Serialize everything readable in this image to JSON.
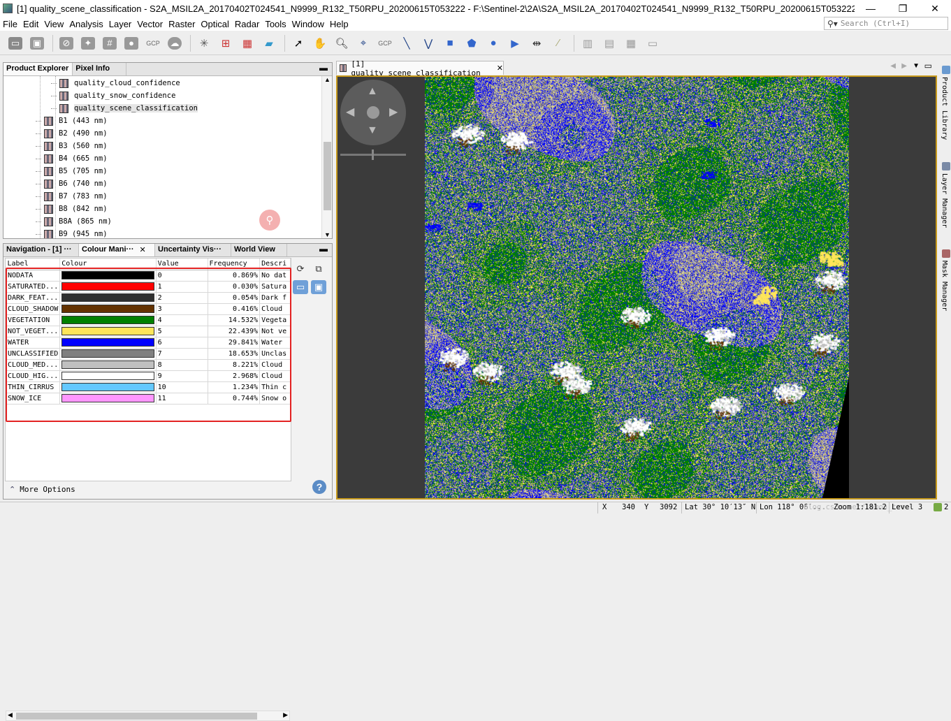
{
  "window": {
    "title": "[1] quality_scene_classification - S2A_MSIL2A_20170402T024541_N9999_R132_T50RPU_20200615T053222 - F:\\Sentinel-2\\2A\\S2A_MSIL2A_20170402T024541_N9999_R132_T50RPU_20200615T053222.SAFE\\MT...",
    "minimize": "—",
    "maximize": "❐",
    "close": "✕"
  },
  "menu": [
    "File",
    "Edit",
    "View",
    "Analysis",
    "Layer",
    "Vector",
    "Raster",
    "Optical",
    "Radar",
    "Tools",
    "Window",
    "Help"
  ],
  "search": {
    "placeholder": "Search (Ctrl+I)",
    "icon": "search-icon"
  },
  "toolbar": {
    "gcp1": "GCP",
    "gcp2": "GCP"
  },
  "product_explorer": {
    "tabs": [
      "Product Explorer",
      "Pixel Info"
    ],
    "items": [
      {
        "label": "quality_cloud_confidence",
        "indent": 2
      },
      {
        "label": "quality_snow_confidence",
        "indent": 2
      },
      {
        "label": "quality_scene_classification",
        "indent": 2,
        "selected": true
      },
      {
        "label": "B1 (443 nm)",
        "indent": 1
      },
      {
        "label": "B2 (490 nm)",
        "indent": 1
      },
      {
        "label": "B3 (560 nm)",
        "indent": 1
      },
      {
        "label": "B4 (665 nm)",
        "indent": 1
      },
      {
        "label": "B5 (705 nm)",
        "indent": 1
      },
      {
        "label": "B6 (740 nm)",
        "indent": 1
      },
      {
        "label": "B7 (783 nm)",
        "indent": 1
      },
      {
        "label": "B8 (842 nm)",
        "indent": 1
      },
      {
        "label": "B8A (865 nm)",
        "indent": 1
      },
      {
        "label": "B9 (945 nm)",
        "indent": 1
      }
    ]
  },
  "bottom_tabs": [
    "Navigation - [1] ···",
    "Colour Mani···",
    "Uncertainty Vis···",
    "World View"
  ],
  "colour_table": {
    "headers": [
      "Label",
      "Colour",
      "Value",
      "Frequency",
      "Descri"
    ],
    "rows": [
      {
        "label": "NODATA",
        "color": "#000000",
        "value": "0",
        "frequency": "0.869%",
        "description": "No dat"
      },
      {
        "label": "SATURATED...",
        "color": "#ff0000",
        "value": "1",
        "frequency": "0.030%",
        "description": "Satura"
      },
      {
        "label": "DARK_FEAT...",
        "color": "#2f2f2f",
        "value": "2",
        "frequency": "0.054%",
        "description": "Dark f"
      },
      {
        "label": "CLOUD_SHADOW",
        "color": "#643200",
        "value": "3",
        "frequency": "0.416%",
        "description": "Cloud"
      },
      {
        "label": "VEGETATION",
        "color": "#008000",
        "value": "4",
        "frequency": "14.532%",
        "description": "Vegeta"
      },
      {
        "label": "NOT_VEGET...",
        "color": "#ffe65a",
        "value": "5",
        "frequency": "22.439%",
        "description": "Not ve"
      },
      {
        "label": "WATER",
        "color": "#0000ff",
        "value": "6",
        "frequency": "29.841%",
        "description": "Water"
      },
      {
        "label": "UNCLASSIFIED",
        "color": "#808080",
        "value": "7",
        "frequency": "18.653%",
        "description": "Unclas"
      },
      {
        "label": "CLOUD_MED...",
        "color": "#c0c0c0",
        "value": "8",
        "frequency": "8.221%",
        "description": "Cloud"
      },
      {
        "label": "CLOUD_HIG...",
        "color": "#ffffff",
        "value": "9",
        "frequency": "2.968%",
        "description": "Cloud"
      },
      {
        "label": "THIN_CIRRUS",
        "color": "#64c8ff",
        "value": "10",
        "frequency": "1.234%",
        "description": "Thin c"
      },
      {
        "label": "SNOW_ICE",
        "color": "#ff96ff",
        "value": "11",
        "frequency": "0.744%",
        "description": "Snow o"
      }
    ]
  },
  "more_options": "More Options",
  "image_view": {
    "tab": "[1] quality_scene_classification"
  },
  "right_sidebar": [
    "Product Library",
    "Layer Manager",
    "Mask Manager"
  ],
  "status": {
    "x_label": "X",
    "x_value": "340",
    "y_label": "Y",
    "y_value": "3092",
    "lat": "Lat 30° 10′13″ N",
    "lon": "Lon 118° 06′...",
    "zoom": "Zoom 1:181.2",
    "level": "Level 3",
    "count": "2",
    "watermark": "blog.csdn.net/lemon_tree"
  },
  "colors": {
    "highlight": "#e32222",
    "frame": "#c79a1c",
    "vegetation": "#008000",
    "water": "#0000ff",
    "not_vegetated": "#ffe65a"
  }
}
